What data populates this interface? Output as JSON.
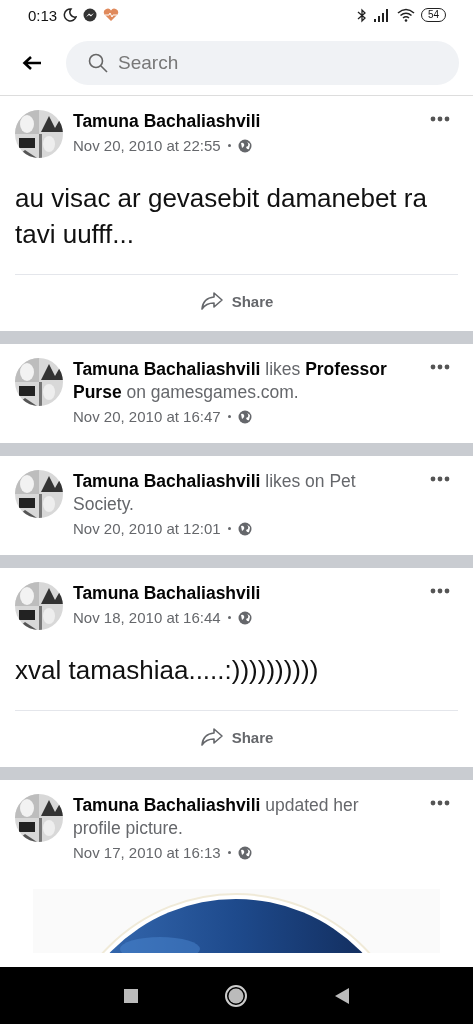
{
  "status_bar": {
    "time": "0:13",
    "battery": "54"
  },
  "header": {
    "search": {
      "placeholder": "Search"
    }
  },
  "posts": [
    {
      "heading": "**Tamuna Bachaliashvili**",
      "time": "Nov 20, 2010 at 22:55",
      "body": "au visac ar gevasebit damanebet ra tavi uufff...",
      "share": "Share"
    },
    {
      "heading": "**Tamuna Bachaliashvili** likes **Professor Purse** on gamesgames.com.",
      "time": "Nov 20, 2010 at 16:47"
    },
    {
      "heading": "**Tamuna Bachaliashvili** likes  on Pet Society.",
      "time": "Nov 20, 2010 at 12:01"
    },
    {
      "heading": "**Tamuna Bachaliashvili**",
      "time": "Nov 18, 2010 at 16:44",
      "body": "xval tamashiaa.....:))))))))))",
      "share": "Share"
    },
    {
      "heading": "**Tamuna Bachaliashvili** updated her profile picture.",
      "time": "Nov 17, 2010 at 16:13"
    }
  ]
}
